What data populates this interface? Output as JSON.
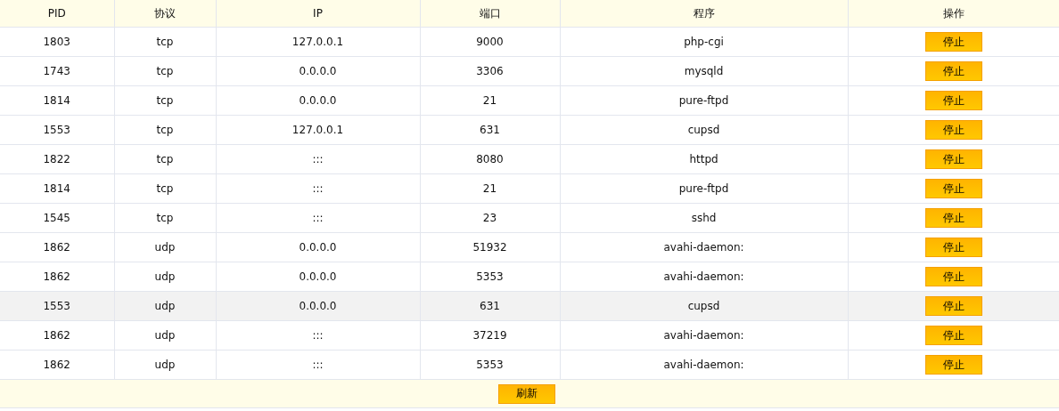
{
  "table": {
    "columns": [
      "PID",
      "协议",
      "IP",
      "端口",
      "程序",
      "操作"
    ],
    "rows": [
      {
        "cells": [
          "1803",
          "tcp",
          "127.0.0.1",
          "9000",
          "php-cgi"
        ],
        "action": "停止",
        "highlighted": false
      },
      {
        "cells": [
          "1743",
          "tcp",
          "0.0.0.0",
          "3306",
          "mysqld"
        ],
        "action": "停止",
        "highlighted": false
      },
      {
        "cells": [
          "1814",
          "tcp",
          "0.0.0.0",
          "21",
          "pure-ftpd"
        ],
        "action": "停止",
        "highlighted": false
      },
      {
        "cells": [
          "1553",
          "tcp",
          "127.0.0.1",
          "631",
          "cupsd"
        ],
        "action": "停止",
        "highlighted": false
      },
      {
        "cells": [
          "1822",
          "tcp",
          ":::",
          "8080",
          "httpd"
        ],
        "action": "停止",
        "highlighted": false
      },
      {
        "cells": [
          "1814",
          "tcp",
          ":::",
          "21",
          "pure-ftpd"
        ],
        "action": "停止",
        "highlighted": false
      },
      {
        "cells": [
          "1545",
          "tcp",
          ":::",
          "23",
          "sshd"
        ],
        "action": "停止",
        "highlighted": false
      },
      {
        "cells": [
          "1862",
          "udp",
          "0.0.0.0",
          "51932",
          "avahi-daemon:"
        ],
        "action": "停止",
        "highlighted": false
      },
      {
        "cells": [
          "1862",
          "udp",
          "0.0.0.0",
          "5353",
          "avahi-daemon:"
        ],
        "action": "停止",
        "highlighted": false
      },
      {
        "cells": [
          "1553",
          "udp",
          "0.0.0.0",
          "631",
          "cupsd"
        ],
        "action": "停止",
        "highlighted": true
      },
      {
        "cells": [
          "1862",
          "udp",
          ":::",
          "37219",
          "avahi-daemon:"
        ],
        "action": "停止",
        "highlighted": false
      },
      {
        "cells": [
          "1862",
          "udp",
          ":::",
          "5353",
          "avahi-daemon:"
        ],
        "action": "停止",
        "highlighted": false
      }
    ],
    "refresh_button": "刷新"
  }
}
